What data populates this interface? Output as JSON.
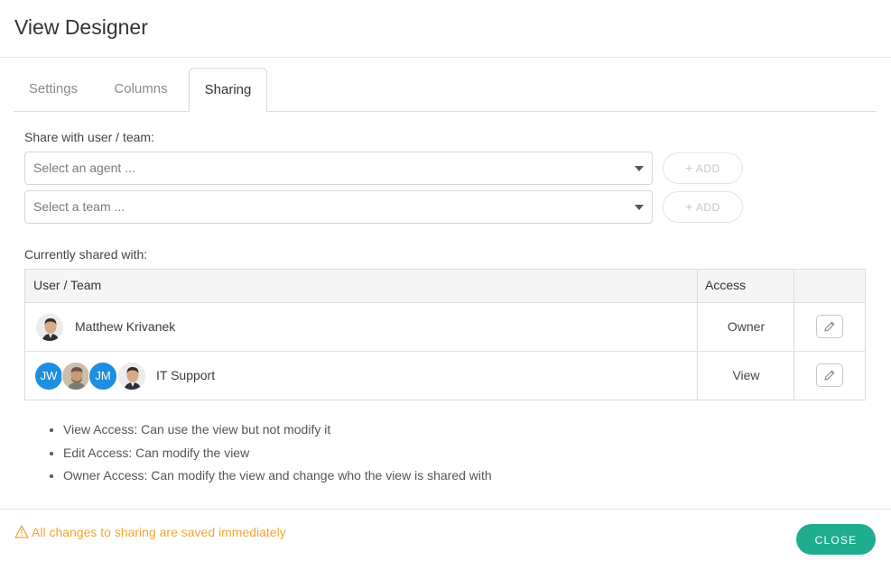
{
  "header": {
    "title": "View Designer"
  },
  "tabs": [
    {
      "label": "Settings",
      "active": false
    },
    {
      "label": "Columns",
      "active": false
    },
    {
      "label": "Sharing",
      "active": true
    }
  ],
  "share": {
    "label": "Share with user / team:",
    "agent_placeholder": "Select an agent ...",
    "team_placeholder": "Select a team ...",
    "add_label": "ADD"
  },
  "shared": {
    "label": "Currently shared with:",
    "columns": [
      "User / Team",
      "Access"
    ],
    "rows": [
      {
        "name": "Matthew Krivanek",
        "access": "Owner",
        "avatars": [
          "photo"
        ]
      },
      {
        "name": "IT Support",
        "access": "View",
        "avatars": [
          "JW",
          "photo",
          "JM",
          "photo"
        ]
      }
    ]
  },
  "notes": [
    "View Access: Can use the view but not modify it",
    "Edit Access: Can modify the view",
    "Owner Access: Can modify the view and change who the view is shared with"
  ],
  "footer": {
    "warning": "All changes to sharing are saved immediately",
    "close_label": "CLOSE"
  },
  "colors": {
    "accent": "#1fad90",
    "warning": "#f0a53a",
    "avatar_blue": "#1e8ee0"
  },
  "icons": {
    "caret": "chevron-down-icon",
    "add": "plus-icon",
    "edit": "pencil-icon",
    "warning": "warning-triangle-icon"
  }
}
